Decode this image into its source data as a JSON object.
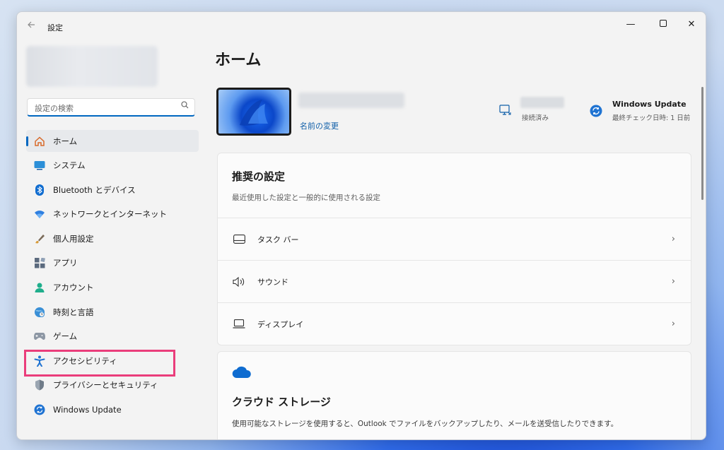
{
  "window": {
    "title": "設定",
    "back_icon": "arrow-left-icon",
    "minimize": "—",
    "maximize": "☐",
    "close": "✕"
  },
  "sidebar": {
    "search_placeholder": "設定の検索",
    "items": [
      {
        "label": "ホーム",
        "icon": "home-icon"
      },
      {
        "label": "システム",
        "icon": "system-icon"
      },
      {
        "label": "Bluetooth とデバイス",
        "icon": "bluetooth-icon"
      },
      {
        "label": "ネットワークとインターネット",
        "icon": "wifi-icon"
      },
      {
        "label": "個人用設定",
        "icon": "brush-icon"
      },
      {
        "label": "アプリ",
        "icon": "apps-icon"
      },
      {
        "label": "アカウント",
        "icon": "account-icon"
      },
      {
        "label": "時刻と言語",
        "icon": "globe-clock-icon"
      },
      {
        "label": "ゲーム",
        "icon": "gamepad-icon"
      },
      {
        "label": "アクセシビリティ",
        "icon": "accessibility-icon"
      },
      {
        "label": "プライバシーとセキュリティ",
        "icon": "shield-icon"
      },
      {
        "label": "Windows Update",
        "icon": "update-icon"
      }
    ],
    "selected_index": 0,
    "highlighted_index": 9
  },
  "main": {
    "page_title": "ホーム",
    "device": {
      "rename_link": "名前の変更"
    },
    "network": {
      "status": "接続済み"
    },
    "windows_update": {
      "title": "Windows Update",
      "subtitle": "最終チェック日時: 1 日前"
    },
    "recommended": {
      "title": "推奨の設定",
      "subtitle": "最近使用した設定と一般的に使用される設定",
      "rows": [
        {
          "label": "タスク バー",
          "icon": "taskbar-icon"
        },
        {
          "label": "サウンド",
          "icon": "speaker-icon"
        },
        {
          "label": "ディスプレイ",
          "icon": "laptop-icon"
        }
      ]
    },
    "cloud": {
      "title": "クラウド ストレージ",
      "description": "使用可能なストレージを使用すると、Outlook でファイルをバックアップしたり、メールを送受信したりできます。"
    }
  },
  "colors": {
    "accent": "#0067c0",
    "highlight_box": "#ea3d7b"
  }
}
